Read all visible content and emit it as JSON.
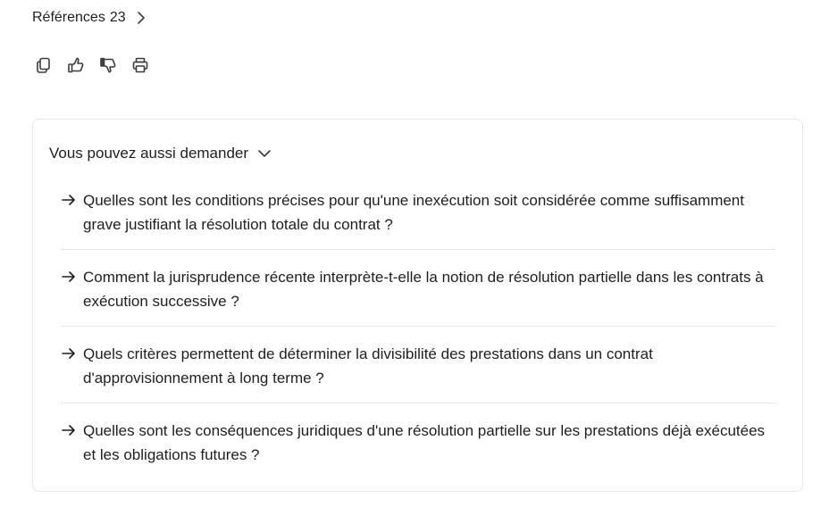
{
  "references": {
    "label": "Références",
    "count": "23"
  },
  "actions": [
    {
      "name": "copy-button",
      "icon": "copy-icon"
    },
    {
      "name": "thumbs-up-button",
      "icon": "thumbs-up-icon"
    },
    {
      "name": "thumbs-down-button",
      "icon": "thumbs-down-icon"
    },
    {
      "name": "print-button",
      "icon": "print-icon"
    }
  ],
  "related": {
    "title": "Vous pouvez aussi demander",
    "items": [
      {
        "text": "Quelles sont les conditions précises pour qu'une inexécution soit considérée comme suffisamment grave justifiant la résolution totale du contrat ?"
      },
      {
        "text": "Comment la jurisprudence récente interprète-t-elle la notion de résolution partielle dans les contrats à exécution successive ?"
      },
      {
        "text": "Quels critères permettent de déterminer la divisibilité des prestations dans un contrat d'approvisionnement à long terme ?"
      },
      {
        "text": "Quelles sont les conséquences juridiques d'une résolution partielle sur les prestations déjà exécutées et les obligations futures ?"
      }
    ]
  },
  "colors": {
    "text": "#1f1f1f",
    "border": "#e6e6e6",
    "icon": "#3c3c3c"
  }
}
